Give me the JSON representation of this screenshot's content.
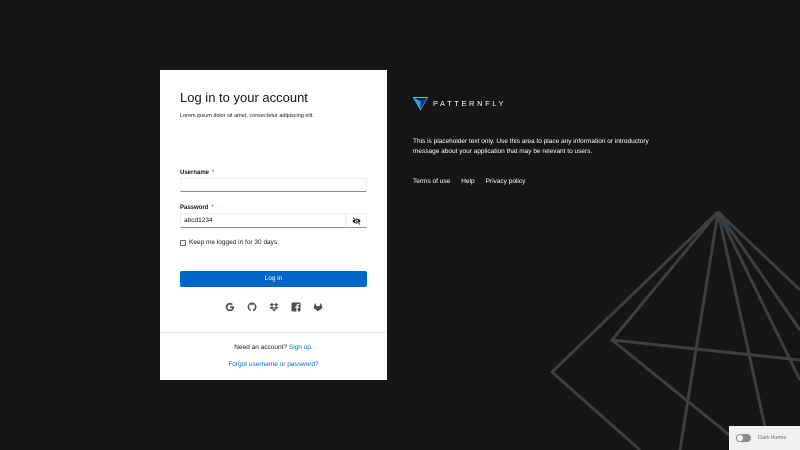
{
  "login": {
    "title": "Log in to your account",
    "subtitle": "Lorem ipsum dolor sit amet, consectetur adipiscing elit.",
    "username_label": "Username",
    "username_value": "",
    "password_label": "Password",
    "password_value": "abcd1234",
    "required_marker": "*",
    "keep_logged_in": "Keep me logged in for 30 days.",
    "keep_logged_in_checked": false,
    "login_button": "Log in",
    "social_icons": [
      "google-icon",
      "github-icon",
      "dropbox-icon",
      "facebook-icon",
      "gitlab-icon"
    ],
    "need_account": "Need an account?",
    "sign_up": "Sign up.",
    "forgot": "Forgot username or password?"
  },
  "brand": {
    "name": "PATTERNFLY",
    "description": "This is placeholder text only. Use this area to place any information or introductory message about your application that may be relevant to users.",
    "footer_links": [
      "Terms of use",
      "Help",
      "Privacy policy"
    ]
  },
  "theme_toggle": {
    "label": "Dark theme",
    "enabled": false
  },
  "colors": {
    "background": "#161616",
    "primary": "#0066cc",
    "required": "#c9190b"
  }
}
